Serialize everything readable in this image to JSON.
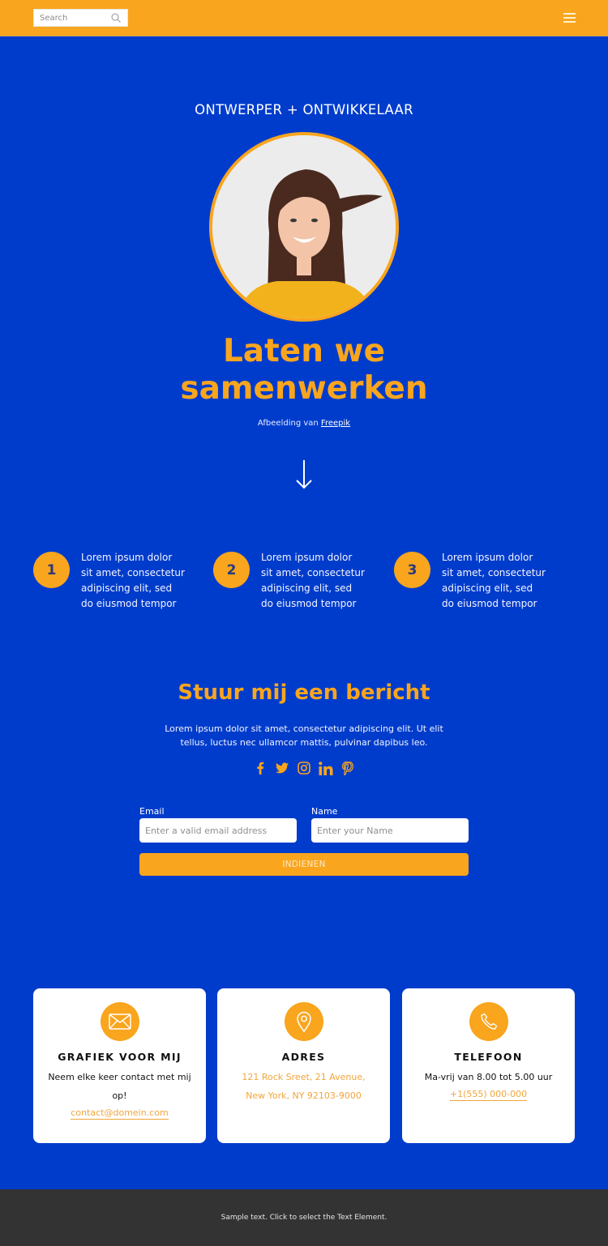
{
  "header": {
    "search_placeholder": "Search",
    "search_icon": "search-icon",
    "menu_icon": "hamburger-menu-icon"
  },
  "hero": {
    "eyebrow": "ONTWERPER + ONTWIKKELAAR",
    "portrait_alt": "Smiling woman with brown hair in a yellow shirt",
    "headline_line1": "Laten we",
    "headline_line2": "samenwerken",
    "credit_prefix": "Afbeelding van ",
    "credit_link": "Freepik",
    "scroll_icon": "arrow-down-icon"
  },
  "steps": [
    {
      "number": "1",
      "text": "Lorem ipsum dolor sit amet, consectetur adipiscing elit, sed do eiusmod tempor"
    },
    {
      "number": "2",
      "text": "Lorem ipsum dolor sit amet, consectetur adipiscing elit, sed do eiusmod tempor"
    },
    {
      "number": "3",
      "text": "Lorem ipsum dolor sit amet, consectetur adipiscing elit, sed do eiusmod tempor"
    }
  ],
  "contact": {
    "title": "Stuur mij een bericht",
    "lead": "Lorem ipsum dolor sit amet, consectetur adipiscing elit. Ut elit tellus, luctus nec ullamcor mattis, pulvinar dapibus leo.",
    "socials": [
      "facebook-icon",
      "twitter-icon",
      "instagram-icon",
      "linkedin-icon",
      "pinterest-icon"
    ],
    "form": {
      "email_label": "Email",
      "email_placeholder": "Enter a valid email address",
      "email_value": "",
      "name_label": "Name",
      "name_placeholder": "Enter your Name",
      "name_value": "",
      "submit_label": "INDIENEN"
    }
  },
  "cards": [
    {
      "icon": "envelope-icon",
      "title": "GRAFIEK VOOR MIJ",
      "line1": "Neem elke keer contact met mij op!",
      "link": "contact@domein.com"
    },
    {
      "icon": "map-pin-icon",
      "title": "ADRES",
      "line1": "121 Rock Sreet, 21 Avenue,",
      "line2": "New York, NY 92103-9000"
    },
    {
      "icon": "phone-icon",
      "title": "TELEFOON",
      "line1": "Ma-vrij van 8.00 tot 5.00 uur",
      "link": "+1(555) 000-000"
    }
  ],
  "footer": {
    "text": "Sample text. Click to select the Text Element."
  },
  "colors": {
    "brand_blue": "#003ccc",
    "accent_orange": "#f9a51e",
    "footer_bg": "#333333"
  }
}
